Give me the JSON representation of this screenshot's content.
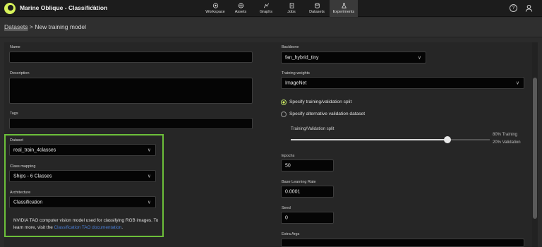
{
  "app": {
    "project_title": "Marine Oblique - Classification"
  },
  "nav": [
    {
      "label": "Workspace",
      "icon": "workspace-icon"
    },
    {
      "label": "Assets",
      "icon": "assets-icon"
    },
    {
      "label": "Graphs",
      "icon": "graphs-icon"
    },
    {
      "label": "Jobs",
      "icon": "jobs-icon"
    },
    {
      "label": "Datasets",
      "icon": "datasets-icon"
    },
    {
      "label": "Experiments",
      "icon": "experiments-icon",
      "active": true
    }
  ],
  "breadcrumb": {
    "link": "Datasets",
    "current": " > New training model"
  },
  "form": {
    "name_label": "Name",
    "name_value": "",
    "description_label": "Description",
    "description_value": "",
    "tags_label": "Tags",
    "tags_value": "",
    "dataset_label": "Dataset",
    "dataset_value": "real_train_4classes",
    "class_mapping_label": "Class mapping",
    "class_mapping_value": "Ships - 6 Classes",
    "architecture_label": "Architecture",
    "architecture_value": "Classification",
    "architecture_note_prefix": "NVIDIA TAO computer vision model used for classifying RGB images. To learn more, visit the ",
    "architecture_note_link": "Classification TAO documentation",
    "architecture_note_suffix": ".",
    "backbone_label": "Backbone",
    "backbone_value": "fan_hybrid_tiny",
    "training_weights_label": "Training weights",
    "training_weights_value": "ImageNet",
    "split_option_1": "Specify training/validation split",
    "split_option_2": "Specify alternative validation dataset",
    "split_selected": 1,
    "split_label": "Training/Validation split",
    "split_training": "80% Training",
    "split_validation": "20% Validation",
    "split_training_fraction": 0.8,
    "epochs_label": "Epochs",
    "epochs_value": "50",
    "lr_label": "Base Learning Rate",
    "lr_value": "0.0001",
    "seed_label": "Seed",
    "seed_value": "0",
    "extra_args_label": "Extra Args"
  },
  "colors": {
    "accent": "#d7f25a",
    "highlight_border": "#6cbf3a",
    "link": "#4a7fd8"
  }
}
